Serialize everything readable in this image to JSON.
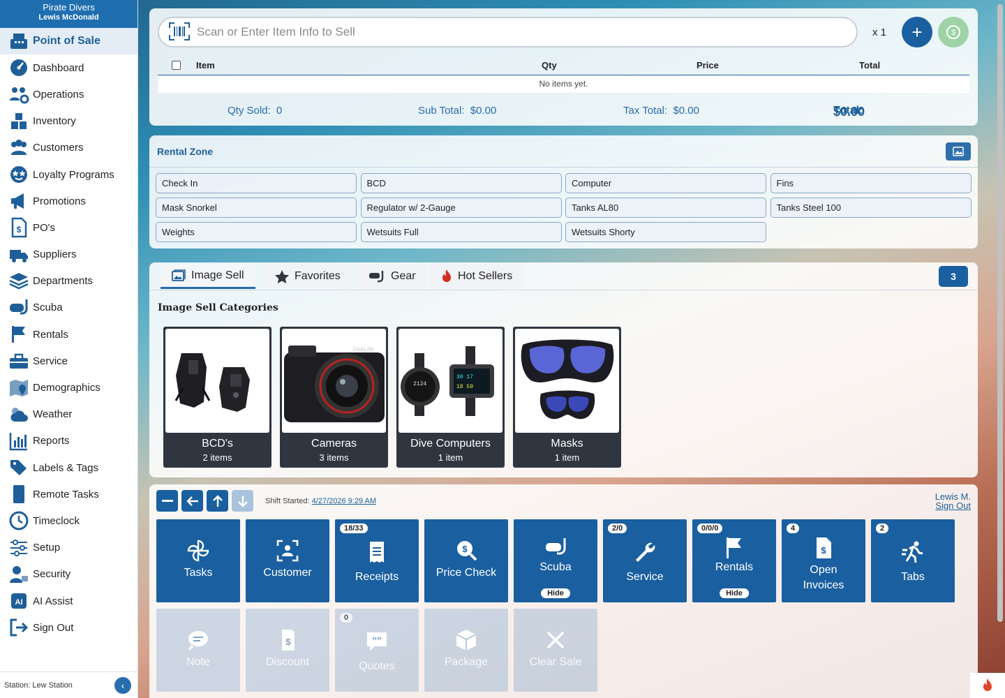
{
  "brand": {
    "name": "Pirate Divers",
    "user": "Lewis McDonald"
  },
  "sidebar": {
    "items": [
      {
        "label": "Point of Sale",
        "icon": "register-icon",
        "active": true
      },
      {
        "label": "Dashboard",
        "icon": "gauge-icon"
      },
      {
        "label": "Operations",
        "icon": "users-gear-icon"
      },
      {
        "label": "Inventory",
        "icon": "boxes-icon"
      },
      {
        "label": "Customers",
        "icon": "users-icon"
      },
      {
        "label": "Loyalty Programs",
        "icon": "star-face-icon"
      },
      {
        "label": "Promotions",
        "icon": "megaphone-icon"
      },
      {
        "label": "PO's",
        "icon": "invoice-dollar-icon"
      },
      {
        "label": "Suppliers",
        "icon": "truck-icon"
      },
      {
        "label": "Departments",
        "icon": "layers-icon"
      },
      {
        "label": "Scuba",
        "icon": "mask-icon"
      },
      {
        "label": "Rentals",
        "icon": "flag-icon"
      },
      {
        "label": "Service",
        "icon": "toolbox-icon"
      },
      {
        "label": "Demographics",
        "icon": "map-pin-icon"
      },
      {
        "label": "Weather",
        "icon": "cloud-sun-icon"
      },
      {
        "label": "Reports",
        "icon": "bar-chart-icon"
      },
      {
        "label": "Labels & Tags",
        "icon": "tags-icon"
      },
      {
        "label": "Remote Tasks",
        "icon": "tablet-icon"
      },
      {
        "label": "Timeclock",
        "icon": "clock-icon"
      },
      {
        "label": "Setup",
        "icon": "sliders-icon"
      },
      {
        "label": "Security",
        "icon": "user-lock-icon"
      },
      {
        "label": "AI Assist",
        "icon": "ai-icon"
      },
      {
        "label": "Sign Out",
        "icon": "sign-out-icon"
      }
    ],
    "station": "Station: Lew Station"
  },
  "sale": {
    "search_placeholder": "Scan or Enter Item Info to Sell",
    "qty_multiplier": "x 1",
    "columns": {
      "item": "Item",
      "qty": "Qty",
      "price": "Price",
      "total": "Total"
    },
    "empty_text": "No items yet.",
    "totals": {
      "qty_sold": "Qty Sold:  0",
      "sub_total": "Sub Total:  $0.00",
      "tax_total": "Tax Total:  $0.00",
      "total_label": "Total:",
      "total_value": "$0.00"
    }
  },
  "rental_zone": {
    "title": "Rental Zone",
    "buttons": [
      "Check In",
      "BCD",
      "Computer",
      "Fins",
      "Mask Snorkel",
      "Regulator w/ 2-Gauge",
      "Tanks AL80",
      "Tanks Steel 100",
      "Weights",
      "Wetsuits Full",
      "Wetsuits Shorty"
    ]
  },
  "tabs": {
    "items": [
      {
        "label": "Image Sell",
        "icon": "image-icon",
        "active": true
      },
      {
        "label": "Favorites",
        "icon": "star-icon"
      },
      {
        "label": "Gear",
        "icon": "mask-snorkel-icon"
      },
      {
        "label": "Hot Sellers",
        "icon": "fire-icon"
      }
    ],
    "count": "3"
  },
  "image_sell": {
    "title": "Image Sell Categories",
    "categories": [
      {
        "name": "BCD's",
        "count": "2 items"
      },
      {
        "name": "Cameras",
        "count": "3 items"
      },
      {
        "name": "Dive Computers",
        "count": "1 item"
      },
      {
        "name": "Masks",
        "count": "1 item"
      }
    ]
  },
  "actions": {
    "shift_label": "Shift Started:",
    "shift_time": "4/27/2026 9:29 AM",
    "user_name": "Lewis M.",
    "sign_out": "Sign Out",
    "tiles": [
      {
        "label": "Tasks",
        "icon": "pinwheel-icon"
      },
      {
        "label": "Customer",
        "icon": "user-scan-icon"
      },
      {
        "label": "Receipts",
        "icon": "receipt-icon",
        "badge": "18/33"
      },
      {
        "label": "Price Check",
        "icon": "price-search-icon"
      },
      {
        "label": "Scuba",
        "icon": "mask-icon",
        "hide": "Hide"
      },
      {
        "label": "Service",
        "icon": "wrench-icon",
        "badge": "2/0"
      },
      {
        "label": "Rentals",
        "icon": "flag-icon",
        "badge": "0/0/0",
        "hide": "Hide"
      },
      {
        "label": "Open Invoices",
        "icon": "invoice-icon",
        "badge": "4"
      },
      {
        "label": "Tabs",
        "icon": "runner-icon",
        "badge": "2"
      },
      {
        "label": "Note",
        "icon": "comment-icon"
      },
      {
        "label": "Discount",
        "icon": "discount-icon"
      },
      {
        "label": "Quotes",
        "icon": "quote-icon",
        "badge": "0"
      },
      {
        "label": "Package",
        "icon": "box-icon"
      },
      {
        "label": "Clear Sale",
        "icon": "x-icon"
      }
    ]
  },
  "colors": {
    "primary": "#1a5fa0",
    "accent_text": "#1f5f99",
    "pay_button": "#9ed3a5"
  }
}
